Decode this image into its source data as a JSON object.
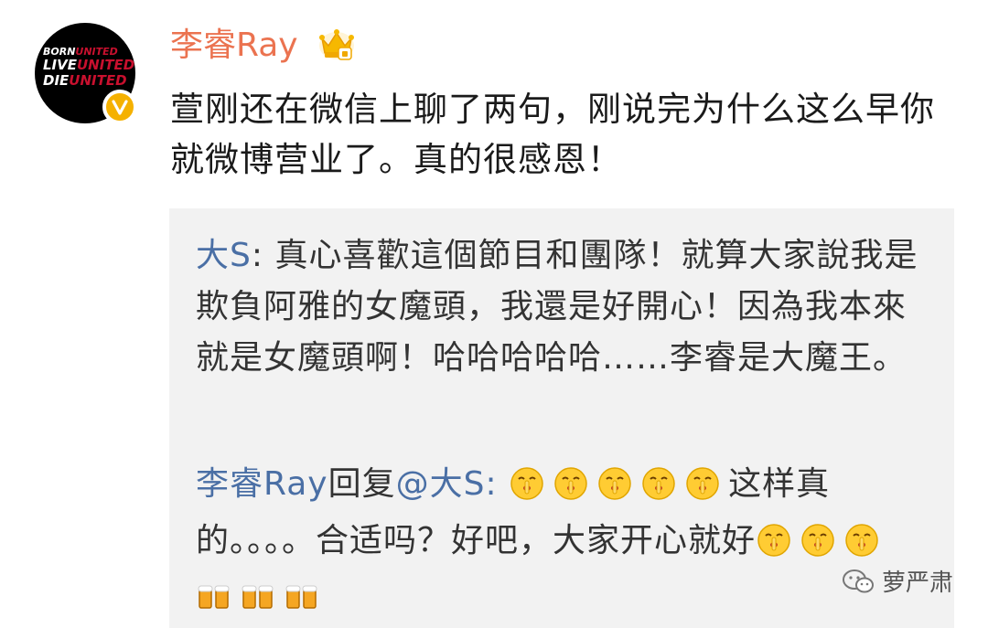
{
  "post": {
    "username": "李睿Ray",
    "text": "萱刚还在微信上聊了两句，刚说完为什么这么早你就微博营业了。真的很感恩！"
  },
  "avatar": {
    "line1_white": "BORN",
    "line1_red": "UNITED",
    "line2_white": "LIVE",
    "line2_red": "UNITED",
    "line3_white": "DIE",
    "line3_red": "UNITED"
  },
  "badges": {
    "verified_icon": "verified-v-icon",
    "vip_icon": "crown-icon"
  },
  "repost": {
    "original_author": "大S",
    "separator": ": ",
    "original_text": "真心喜歡這個節目和團隊！就算大家說我是欺負阿雅的女魔頭，我還是好開心！因為我本來就是女魔頭啊！哈哈哈哈哈……李睿是大魔王。",
    "reply_author": "李睿Ray",
    "reply_verb": "回复",
    "reply_mention": "@大S",
    "reply_colon": ":",
    "reply_text_1": "这样真的。。。。合适吗？好吧，大家开心就好",
    "emoji_names": [
      "shush-emoji",
      "beer-emoji"
    ]
  },
  "watermark": {
    "text": "萝严肃",
    "icon": "wechat-icon"
  },
  "colors": {
    "username": "#eb7350",
    "link": "#4a6fa5",
    "verified": "#f5b100",
    "repost_bg": "#f2f2f2"
  }
}
